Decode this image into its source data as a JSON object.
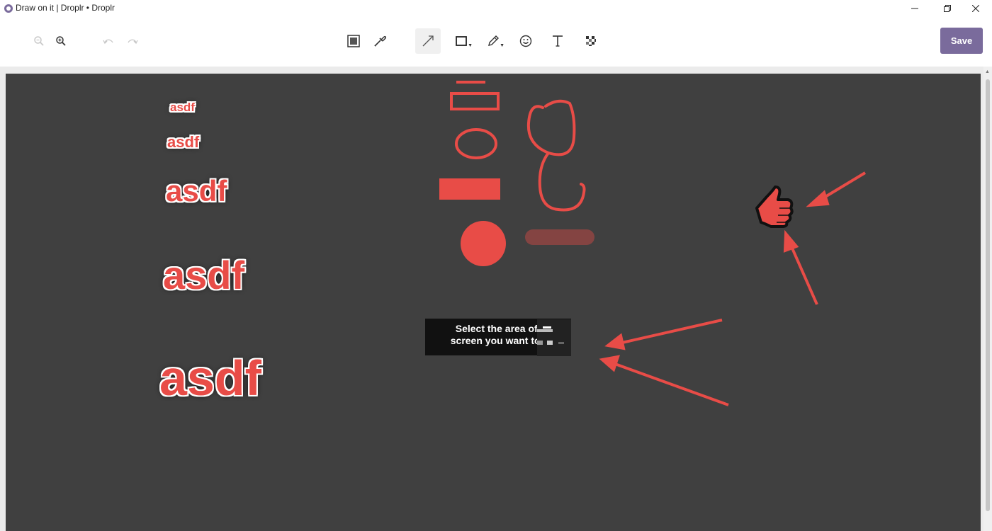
{
  "window": {
    "title": "Draw on it | Droplr • Droplr",
    "minimize_icon": "minimize-icon",
    "restore_icon": "restore-icon",
    "close_icon": "close-icon"
  },
  "toolbar": {
    "zoom_out_icon": "zoom-out-icon",
    "zoom_in_icon": "zoom-in-icon",
    "undo_icon": "undo-icon",
    "redo_icon": "redo-icon",
    "tools": [
      "crop-icon",
      "color-picker-icon",
      "arrow-tool-icon",
      "rectangle-tool-icon",
      "pencil-tool-icon",
      "emoji-icon",
      "text-tool-icon",
      "pixelate-icon"
    ],
    "active_tool": "arrow-tool-icon",
    "save_label": "Save"
  },
  "canvas": {
    "background_color": "#404040",
    "annotation_color": "#e84c47",
    "texts": [
      "asdf",
      "asdf",
      "asdf",
      "asdf",
      "asdf"
    ],
    "tooltip_text_line1": "Select the area of t",
    "tooltip_text_line2": "screen you want to s"
  },
  "colors": {
    "accent": "#7a6b9c",
    "annotation": "#e84c47"
  }
}
